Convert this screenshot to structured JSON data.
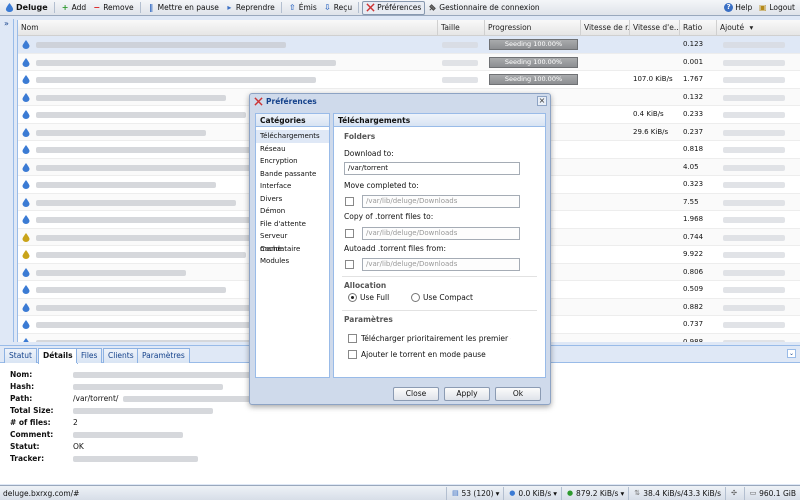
{
  "toolbar": {
    "brand": "Deluge",
    "add": "Add",
    "remove": "Remove",
    "pause": "Mettre en pause",
    "resume": "Reprendre",
    "up": "Émis",
    "down": "Reçu",
    "preferences": "Préférences",
    "connection_manager": "Gestionnaire de connexion",
    "help": "Help",
    "logout": "Logout"
  },
  "collapse_glyph": "»",
  "grid": {
    "columns": [
      "Nom",
      "Taille",
      "Progression",
      "Vitesse de r...",
      "Vitesse d'e...",
      "Ratio",
      "Ajouté"
    ],
    "sort_indicator": "▾",
    "rows": [
      {
        "progress": "Seeding 100.00%",
        "up_speed": "",
        "ratio": "0.123",
        "icon": "download-icon"
      },
      {
        "progress": "Seeding 100.00%",
        "up_speed": "",
        "ratio": "0.001",
        "icon": "download-icon"
      },
      {
        "progress": "Seeding 100.00%",
        "up_speed": "107.0 KiB/s",
        "ratio": "1.767",
        "icon": "download-icon"
      },
      {
        "progress": "",
        "up_speed": "",
        "ratio": "0.132",
        "icon": "download-icon"
      },
      {
        "progress": "",
        "up_speed": "0.4 KiB/s",
        "ratio": "0.233",
        "icon": "download-icon"
      },
      {
        "progress": "",
        "up_speed": "29.6 KiB/s",
        "ratio": "0.237",
        "icon": "download-icon"
      },
      {
        "progress": "",
        "up_speed": "",
        "ratio": "0.818",
        "icon": "download-icon"
      },
      {
        "progress": "",
        "up_speed": "",
        "ratio": "4.05",
        "icon": "download-icon"
      },
      {
        "progress": "",
        "up_speed": "",
        "ratio": "0.323",
        "icon": "download-icon"
      },
      {
        "progress": "",
        "up_speed": "",
        "ratio": "7.55",
        "icon": "download-icon"
      },
      {
        "progress": "",
        "up_speed": "",
        "ratio": "1.968",
        "icon": "download-icon"
      },
      {
        "progress": "",
        "up_speed": "",
        "ratio": "0.744",
        "icon": "warning-icon"
      },
      {
        "progress": "",
        "up_speed": "",
        "ratio": "9.922",
        "icon": "warning-icon"
      },
      {
        "progress": "",
        "up_speed": "",
        "ratio": "0.806",
        "icon": "download-icon"
      },
      {
        "progress": "",
        "up_speed": "",
        "ratio": "0.509",
        "icon": "download-icon"
      },
      {
        "progress": "",
        "up_speed": "",
        "ratio": "0.882",
        "icon": "download-icon"
      },
      {
        "progress": "",
        "up_speed": "",
        "ratio": "0.737",
        "icon": "download-icon"
      },
      {
        "progress": "",
        "up_speed": "",
        "ratio": "0.988",
        "icon": "download-icon"
      }
    ]
  },
  "details": {
    "tabs": [
      "Statut",
      "Détails",
      "Files",
      "Clients",
      "Paramètres"
    ],
    "active_tab": "Détails",
    "fields": [
      {
        "label": "Nom:",
        "value": ""
      },
      {
        "label": "Hash:",
        "value": ""
      },
      {
        "label": "Path:",
        "value": "/var/torrent/"
      },
      {
        "label": "Total Size:",
        "value": ""
      },
      {
        "label": "# of files:",
        "value": "2"
      },
      {
        "label": "Comment:",
        "value": ""
      },
      {
        "label": "Statut:",
        "value": "OK"
      },
      {
        "label": "Tracker:",
        "value": ""
      }
    ]
  },
  "statusbar": {
    "url": "deluge.bxrxg.com/#",
    "connections": "53 (120)",
    "download": "0.0 KiB/s",
    "upload": "879.2 KiB/s",
    "protocol": "38.4 KiB/s/43.3 KiB/s",
    "disk": "960.1 GiB"
  },
  "dialog": {
    "title": "Préférences",
    "close": "×",
    "categories_header": "Catégories",
    "categories": [
      "Téléchargements",
      "Réseau",
      "Encryption",
      "Bande passante",
      "Interface",
      "Divers",
      "Démon",
      "File d'attente",
      "Serveur mandataire",
      "Cache",
      "Modules"
    ],
    "selected_category": "Téléchargements",
    "content_header": "Téléchargements",
    "folders_legend": "Folders",
    "download_to_label": "Download to:",
    "download_to_value": "/var/torrent",
    "move_completed_label": "Move completed to:",
    "move_completed_value": "/var/lib/deluge/Downloads",
    "copy_torrent_label": "Copy of .torrent files to:",
    "copy_torrent_value": "/var/lib/deluge/Downloads",
    "autoadd_label": "Autoadd .torrent files from:",
    "autoadd_value": "/var/lib/deluge/Downloads",
    "allocation_legend": "Allocation",
    "use_full": "Use Full",
    "use_compact": "Use Compact",
    "params_legend": "Paramètres",
    "prioritize_first_last": "Télécharger prioritairement les premier et",
    "add_paused": "Ajouter le torrent en mode pause",
    "buttons": {
      "close": "Close",
      "apply": "Apply",
      "ok": "Ok"
    }
  },
  "colors": {
    "accent": "#15428b",
    "panel_bg": "#dfe8f6",
    "border": "#99bbe8"
  }
}
